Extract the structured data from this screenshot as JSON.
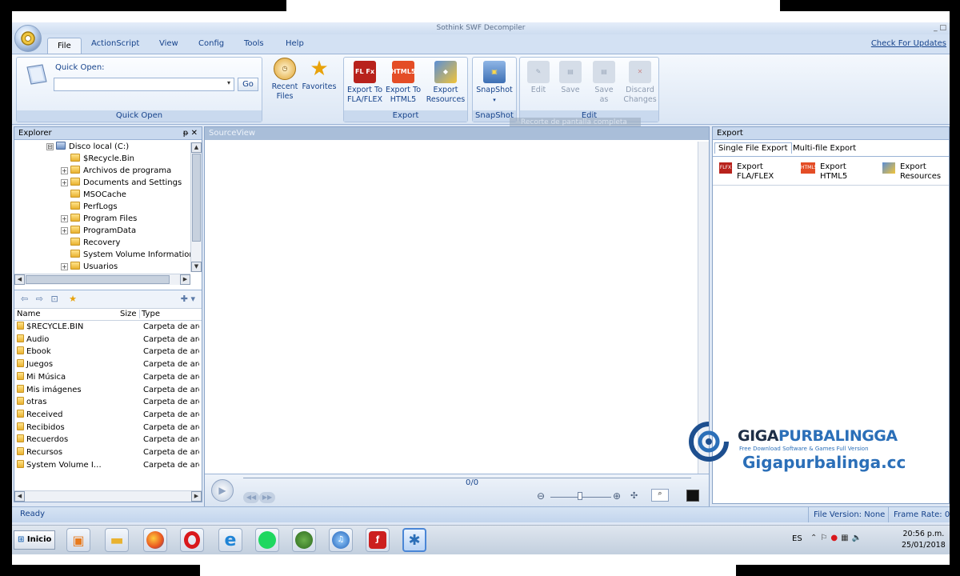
{
  "window": {
    "title": "Sothink SWF Decompiler",
    "controls": "_ □"
  },
  "tabs": [
    "File",
    "ActionScript",
    "View",
    "Config",
    "Tools",
    "Help"
  ],
  "check_updates": "Check For Updates",
  "ribbon": {
    "quick_open": {
      "label": "Quick Open:",
      "go": "Go",
      "group": "Quick Open"
    },
    "recent_files": "Recent Files",
    "favorites": "Favorites",
    "export_fla": {
      "line1": "Export To",
      "line2": "FLA/FLEX"
    },
    "export_html5": {
      "line1": "Export To",
      "line2": "HTML5"
    },
    "export_resources": {
      "line1": "Export",
      "line2": "Resources"
    },
    "export_group": "Export",
    "snapshot": "SnapShot",
    "snapshot_group": "SnapShot",
    "edit": "Edit",
    "save": "Save",
    "save_as": {
      "line1": "Save",
      "line2": "as"
    },
    "discard": {
      "line1": "Discard",
      "line2": "Changes"
    },
    "edit_group": "Edit",
    "tooltip_overlay": "Recorte de pantalla completa"
  },
  "explorer": {
    "title": "Explorer",
    "pin": "ᵽ ✕",
    "tree": [
      {
        "label": "Disco local (C:)",
        "expand": "⊟",
        "level": 0
      },
      {
        "label": "$Recycle.Bin",
        "expand": "",
        "level": 1
      },
      {
        "label": "Archivos de programa",
        "expand": "+",
        "level": 1
      },
      {
        "label": "Documents and Settings",
        "expand": "+",
        "level": 1
      },
      {
        "label": "MSOCache",
        "expand": "",
        "level": 1
      },
      {
        "label": "PerfLogs",
        "expand": "",
        "level": 1
      },
      {
        "label": "Program Files",
        "expand": "+",
        "level": 1
      },
      {
        "label": "ProgramData",
        "expand": "+",
        "level": 1
      },
      {
        "label": "Recovery",
        "expand": "",
        "level": 1
      },
      {
        "label": "System Volume Information",
        "expand": "",
        "level": 1
      },
      {
        "label": "Usuarios",
        "expand": "+",
        "level": 1
      }
    ],
    "list_headers": {
      "name": "Name",
      "size": "Size",
      "type": "Type"
    },
    "list": [
      {
        "name": "$RECYCLE.BIN",
        "type": "Carpeta de arc"
      },
      {
        "name": "Audio",
        "type": "Carpeta de arc"
      },
      {
        "name": "Ebook",
        "type": "Carpeta de arc"
      },
      {
        "name": "Juegos",
        "type": "Carpeta de arc"
      },
      {
        "name": "Mi Música",
        "type": "Carpeta de arc"
      },
      {
        "name": "Mis imágenes",
        "type": "Carpeta de arc"
      },
      {
        "name": "otras",
        "type": "Carpeta de arc"
      },
      {
        "name": "Received",
        "type": "Carpeta de arc"
      },
      {
        "name": "Recibidos",
        "type": "Carpeta de arc"
      },
      {
        "name": "Recuerdos",
        "type": "Carpeta de arc"
      },
      {
        "name": "Recursos",
        "type": "Carpeta de arc"
      },
      {
        "name": "System Volume I…",
        "type": "Carpeta de arc"
      }
    ]
  },
  "sourceview": {
    "title": "SourceView",
    "frame_counter": "0/0"
  },
  "export_panel": {
    "title": "Export",
    "tabs": [
      "Single File Export",
      "Multi-file Export"
    ],
    "buttons": [
      {
        "line1": "Export",
        "line2": "FLA/FLEX",
        "badge": "FLFX"
      },
      {
        "line1": "Export",
        "line2": "HTML5",
        "badge": "HTML5"
      },
      {
        "line1": "Export",
        "line2": "Resources",
        "badge": ""
      }
    ]
  },
  "status": {
    "ready": "Ready",
    "file_version": "File Version: None",
    "frame_rate": "Frame Rate: 0 f"
  },
  "taskbar": {
    "start": "Inicio",
    "lang": "ES",
    "time": "20:56 p.m.",
    "date": "25/01/2018"
  },
  "watermark": {
    "brand_a": "GIGA",
    "brand_b": "PURBALINGGA",
    "tagline": "Free Download Software & Games Full Version",
    "site": "Gigapurbalinga.cc"
  },
  "colors": {
    "ribbon_text": "#15428b",
    "panel_title_bg": "#c9d9ee",
    "sourceview_title_bg": "#a9bed9",
    "accent_blue": "#2b6fb8"
  }
}
